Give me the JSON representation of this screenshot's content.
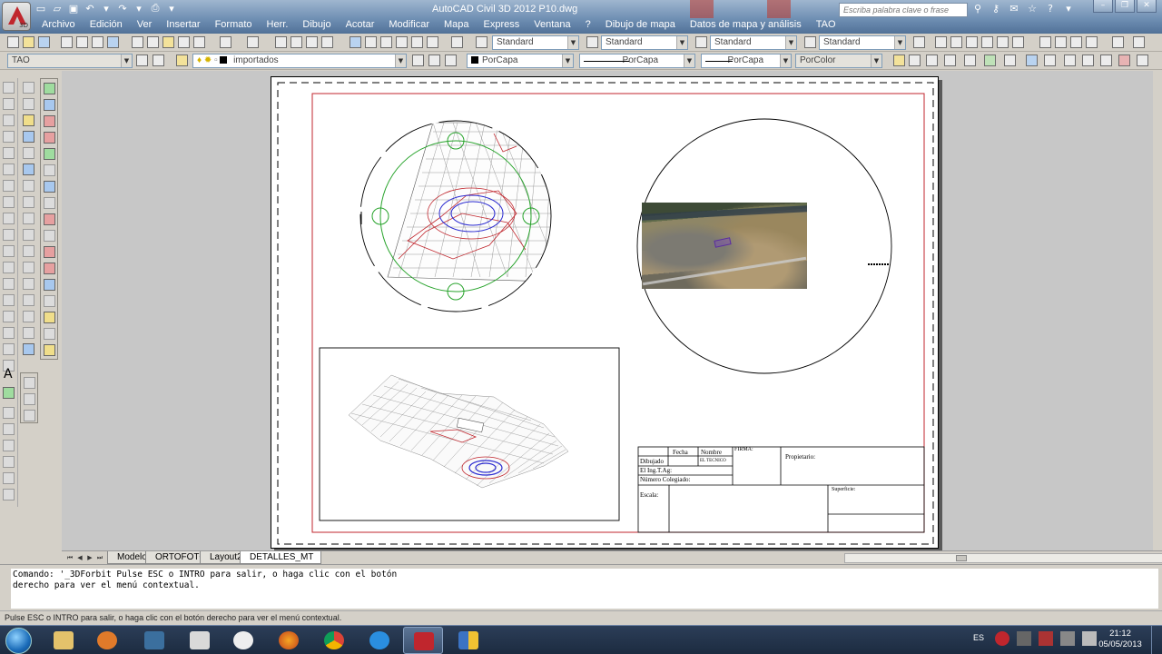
{
  "window": {
    "title": "AutoCAD Civil 3D 2012    P10.dwg",
    "app_version_badge": "3D",
    "search_placeholder": "Escriba palabra clave o frase",
    "menus": [
      "Archivo",
      "Edición",
      "Ver",
      "Insertar",
      "Formato",
      "Herr.",
      "Dibujo",
      "Acotar",
      "Modificar",
      "Mapa",
      "Express",
      "Ventana",
      "?",
      "Dibujo de mapa",
      "Datos de mapa y análisis",
      "TAO"
    ]
  },
  "toolbar1": {
    "text_style": "Standard",
    "dim_style": "Standard",
    "table_style": "Standard",
    "mleader_style": "Standard"
  },
  "toolbar2": {
    "workspace": "TAO",
    "layer": "importados",
    "color": "PorCapa",
    "linetype": "PorCapa",
    "lineweight": "PorCapa",
    "plotstyle": "PorColor"
  },
  "title_block": {
    "col_fecha": "Fecha",
    "col_nombre": "Nombre",
    "col_firma": "FIRMA:",
    "row_dibujado": "Dibujado",
    "dibujado_nombre": "EL TECNICO",
    "row_ingenier": "El Ing.T.Ag:",
    "row_numero": "Número Colegiado:",
    "propietario": "Propietario:",
    "escala": "Escala:",
    "superficie": "Superficie:"
  },
  "tabs": [
    "Modelo",
    "ORTOFOTO",
    "Layout2",
    "DETALLES_MT"
  ],
  "active_tab": "DETALLES_MT",
  "command": {
    "line1": "Comando: '_3DForbit Pulse ESC o INTRO para salir, o haga clic con el botón",
    "line2": "derecho para ver el menú contextual."
  },
  "status_text": "Pulse ESC o INTRO para salir, o haga clic con el botón derecho para ver el menú contextual.",
  "taskbar": {
    "language": "ES",
    "time": "21:12",
    "date": "05/05/2013"
  },
  "colors": {
    "titlebar": "#6f8fb3",
    "drawing_bg": "#c7c7c7",
    "viewport_red": "#c0262d",
    "circle_green": "#27a32b",
    "mesh_blue": "#2a2ad0"
  }
}
